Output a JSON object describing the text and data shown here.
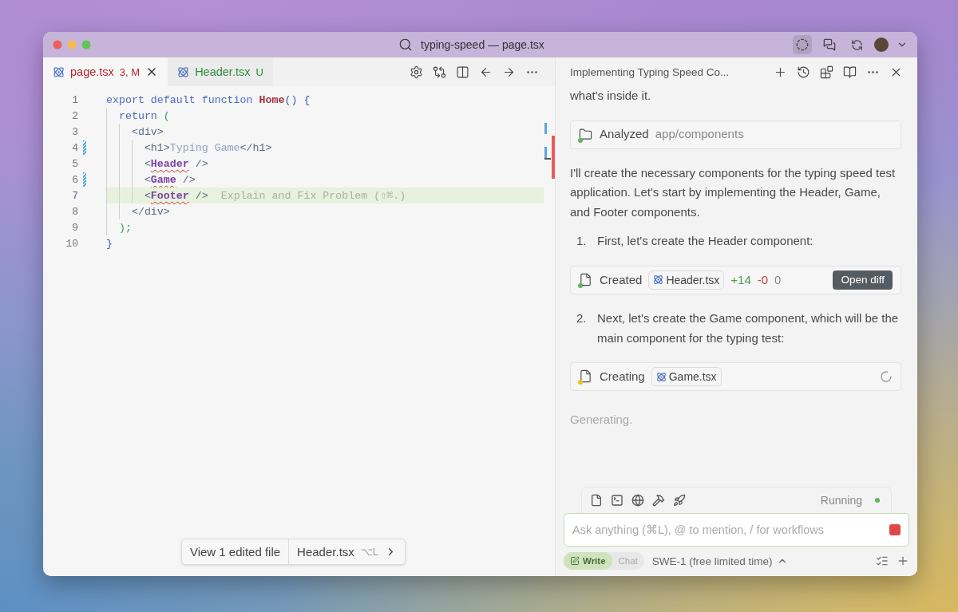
{
  "window": {
    "title": "typing-speed — page.tsx"
  },
  "tabs": [
    {
      "label": "page.tsx",
      "badge": "3, M",
      "color": "#b3262d",
      "selected": true
    },
    {
      "label": "Header.tsx",
      "badge": "U",
      "color": "#2e8b3a",
      "selected": false
    }
  ],
  "code_lines": [
    {
      "number": "1",
      "changed": false,
      "highlighted": false,
      "tokens": [
        {
          "kind": "kw",
          "text": "export default function ",
          "error": false
        },
        {
          "kind": "fn",
          "text": "Home",
          "error": false
        },
        {
          "kind": "punct",
          "text": "() {",
          "error": false
        }
      ]
    },
    {
      "number": "2",
      "changed": false,
      "highlighted": false,
      "tokens": [
        {
          "kind": "kw",
          "text": "  return ",
          "error": false
        },
        {
          "kind": "paren",
          "text": "(",
          "error": false
        }
      ]
    },
    {
      "number": "3",
      "changed": false,
      "highlighted": false,
      "tokens": [
        {
          "kind": "tag",
          "text": "    <div>",
          "error": false
        }
      ]
    },
    {
      "number": "4",
      "changed": true,
      "highlighted": false,
      "tokens": [
        {
          "kind": "tag",
          "text": "      <h1>",
          "error": false
        },
        {
          "kind": "text",
          "text": "Typing Game",
          "error": false
        },
        {
          "kind": "tag",
          "text": "</h1>",
          "error": false
        }
      ]
    },
    {
      "number": "5",
      "changed": false,
      "highlighted": false,
      "tokens": [
        {
          "kind": "tag",
          "text": "      <",
          "error": false
        },
        {
          "kind": "component",
          "text": "Header",
          "error": true
        },
        {
          "kind": "tag",
          "text": " />",
          "error": false
        }
      ]
    },
    {
      "number": "6",
      "changed": true,
      "highlighted": false,
      "tokens": [
        {
          "kind": "tag",
          "text": "      <",
          "error": false
        },
        {
          "kind": "component",
          "text": "Game",
          "error": true
        },
        {
          "kind": "tag",
          "text": " />",
          "error": false
        }
      ]
    },
    {
      "number": "7",
      "changed": false,
      "highlighted": true,
      "hint": "Explain and Fix Problem (⇧⌘.)",
      "tokens": [
        {
          "kind": "tag",
          "text": "      <",
          "error": false
        },
        {
          "kind": "component",
          "text": "Footer",
          "error": true
        },
        {
          "kind": "tag",
          "text": " />",
          "error": false
        }
      ]
    },
    {
      "number": "8",
      "changed": false,
      "highlighted": false,
      "tokens": [
        {
          "kind": "tag",
          "text": "    </div>",
          "error": false
        }
      ]
    },
    {
      "number": "9",
      "changed": false,
      "highlighted": false,
      "tokens": [
        {
          "kind": "paren",
          "text": "  );",
          "error": false
        }
      ]
    },
    {
      "number": "10",
      "changed": false,
      "highlighted": false,
      "tokens": [
        {
          "kind": "punct",
          "text": "}",
          "error": false
        }
      ]
    }
  ],
  "edited_bar": {
    "label": "View 1 edited file",
    "file": "Header.tsx",
    "shortcut": "⌥L"
  },
  "chat": {
    "title": "Implementing Typing Speed Co...",
    "blocks": [
      {
        "kind": "text",
        "text": "what's inside it."
      },
      {
        "kind": "tool",
        "verb": "Analyzed",
        "target": "app/components",
        "color": "#5cb85c"
      },
      {
        "kind": "text",
        "text": "I'll create the necessary components for the typing speed test application. Let's start by implementing the Header, Game, and Footer components."
      },
      {
        "kind": "step",
        "number": "1.",
        "text": "First, let's create the Header component:"
      },
      {
        "kind": "file",
        "verb": "Created",
        "file": "Header.tsx",
        "added": "+14",
        "removed": "-0",
        "extra": "0",
        "action": "Open diff",
        "color": "#5cb85c",
        "loading": false
      },
      {
        "kind": "step",
        "number": "2.",
        "text": "Next, let's create the Game component, which will be the main component for the typing test:"
      },
      {
        "kind": "file",
        "verb": "Creating",
        "file": "Game.tsx",
        "color": "#f0c020",
        "loading": true
      },
      {
        "kind": "status",
        "text": "Generating."
      }
    ],
    "run_status": {
      "label": "Running",
      "color": "#5fb35f"
    },
    "input": {
      "placeholder": "Ask anything (⌘L), @ to mention, / for workflows"
    },
    "modes": [
      {
        "label": "Write",
        "selected": true
      },
      {
        "label": "Chat",
        "selected": false
      }
    ],
    "model": "SWE-1 (free limited time)"
  }
}
